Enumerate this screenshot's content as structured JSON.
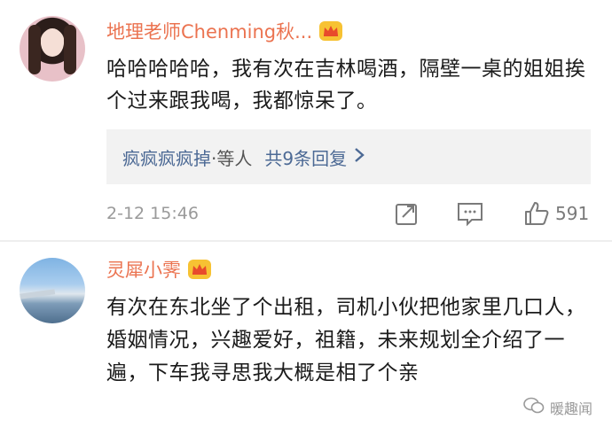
{
  "comments": [
    {
      "username": "地理老师Chenming秋...",
      "text": "哈哈哈哈哈，我有次在吉林喝酒，隔壁一桌的姐姐挨个过来跟我喝，我都惊呆了。",
      "replies": {
        "first_replier": "疯疯疯疯掉",
        "suffix": "·等人",
        "count_label": "共9条回复"
      },
      "time": "2-12 15:46",
      "likes": "591"
    },
    {
      "username": "灵犀小霁",
      "text": "有次在东北坐了个出租，司机小伙把他家里几口人，婚姻情况，兴趣爱好，祖籍，未来规划全介绍了一遍，下车我寻思我大概是相了个亲"
    }
  ],
  "watermark": {
    "text": "暖趣闻"
  },
  "colors": {
    "username": "#eb7350",
    "link": "#4d6a95",
    "crown": "#f7c233"
  }
}
